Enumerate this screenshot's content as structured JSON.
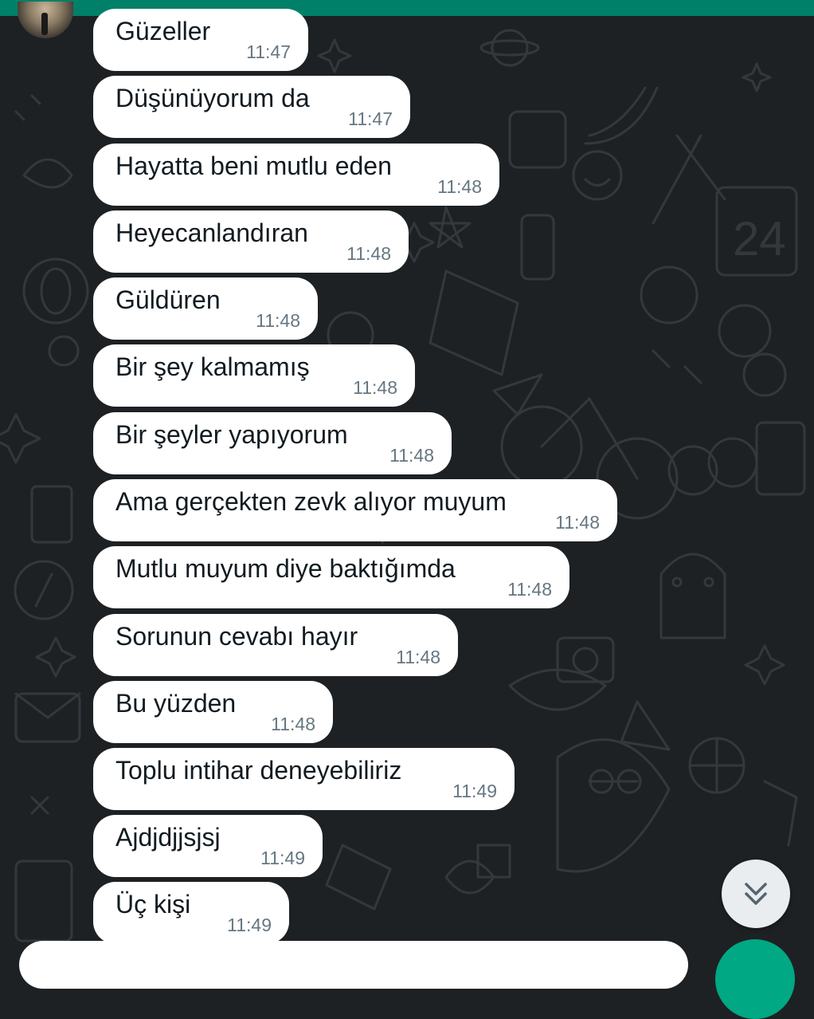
{
  "colors": {
    "header": "#008069",
    "background": "#1e2124",
    "bubble": "#ffffff",
    "message_text": "#111b21",
    "timestamp": "#667781",
    "send_button": "#00a884"
  },
  "header": {
    "avatar_icon": "contact-avatar"
  },
  "messages": [
    {
      "text": "Güzeller",
      "time": "11:47"
    },
    {
      "text": "Düşünüyorum da",
      "time": "11:47"
    },
    {
      "text": "Hayatta beni mutlu eden",
      "time": "11:48"
    },
    {
      "text": "Heyecanlandıran",
      "time": "11:48"
    },
    {
      "text": "Güldüren",
      "time": "11:48"
    },
    {
      "text": "Bir şey kalmamış",
      "time": "11:48"
    },
    {
      "text": "Bir şeyler yapıyorum",
      "time": "11:48"
    },
    {
      "text": "Ama gerçekten zevk alıyor muyum",
      "time": "11:48"
    },
    {
      "text": "Mutlu muyum diye baktığımda",
      "time": "11:48"
    },
    {
      "text": "Sorunun cevabı hayır",
      "time": "11:48"
    },
    {
      "text": "Bu yüzden",
      "time": "11:48"
    },
    {
      "text": "Toplu intihar deneyebiliriz",
      "time": "11:49"
    },
    {
      "text": "Ajdjdjjsjsj",
      "time": "11:49"
    },
    {
      "text": "Üç kişi",
      "time": "11:49"
    }
  ],
  "controls": {
    "scroll_down_icon": "double-chevron-down-icon",
    "send_icon": "send-icon"
  }
}
